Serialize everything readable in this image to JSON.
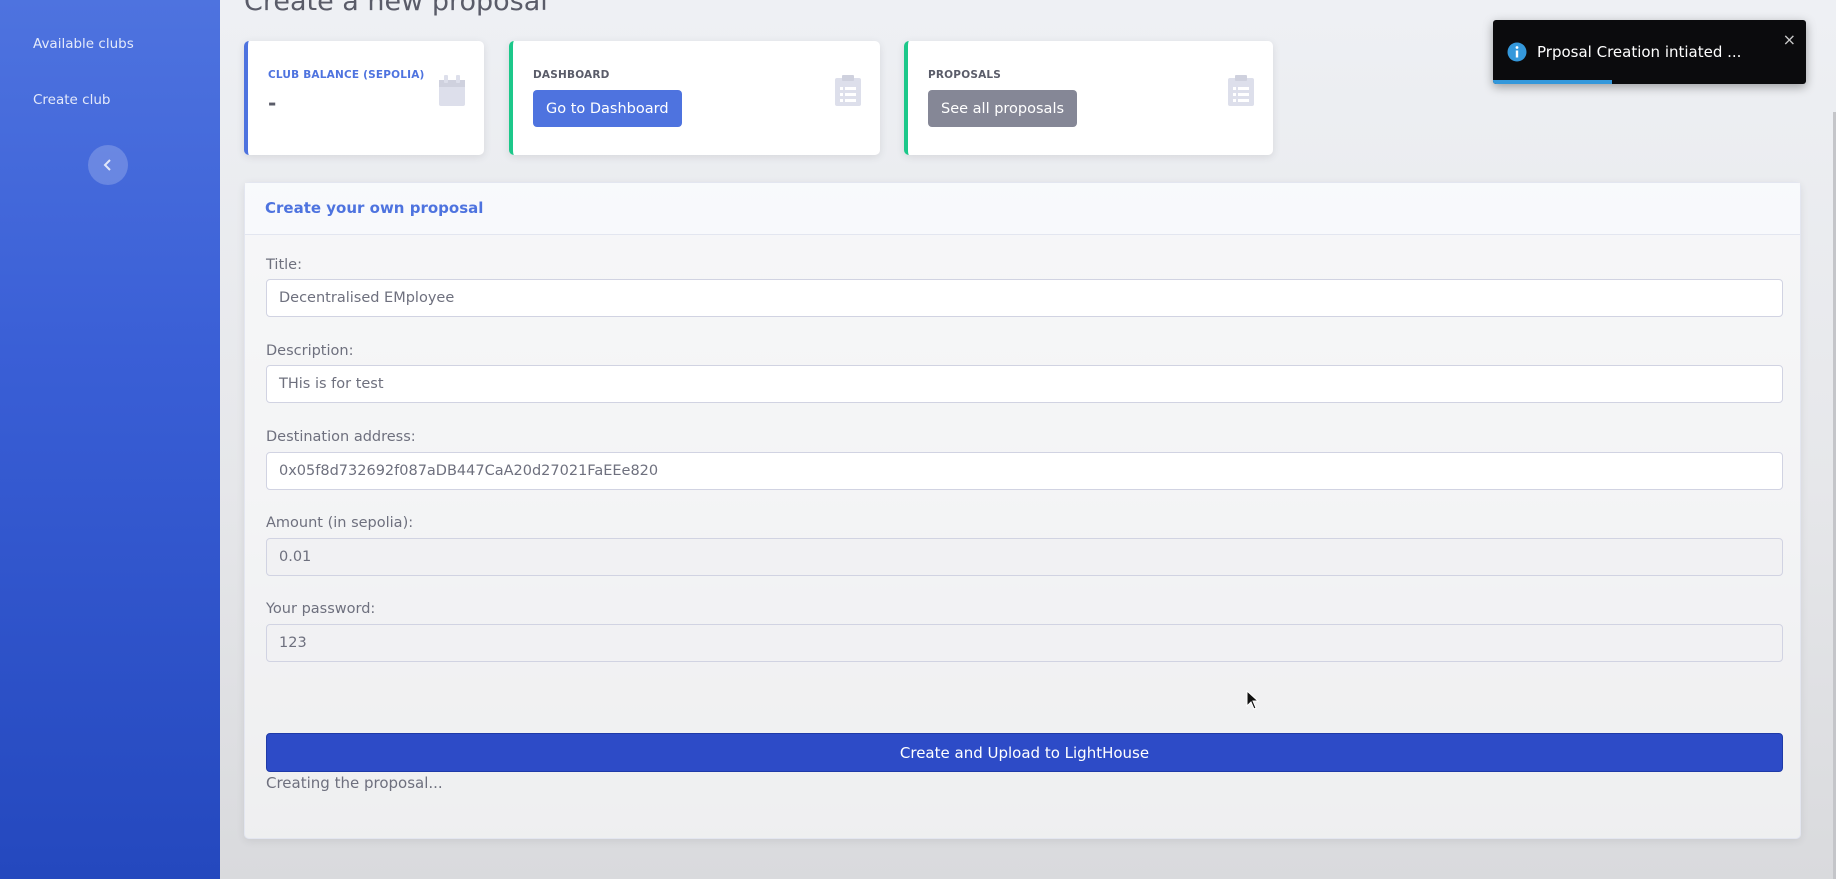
{
  "sidebar": {
    "items": [
      {
        "label": "Available clubs"
      },
      {
        "label": "Create club"
      }
    ],
    "toggle_icon": "chevron-left-icon"
  },
  "page": {
    "title": "Create a new proposal"
  },
  "cards": {
    "balance": {
      "label": "CLUB BALANCE (SEPOLIA)",
      "value": "-",
      "icon": "calendar-icon"
    },
    "dashboard": {
      "label": "DASHBOARD",
      "button": "Go to Dashboard",
      "icon": "clipboard-list-icon"
    },
    "proposals": {
      "label": "PROPOSALS",
      "button": "See all proposals",
      "icon": "clipboard-list-icon"
    }
  },
  "form": {
    "header": "Create your own proposal",
    "title_label": "Title:",
    "title_value": "Decentralised EMployee",
    "description_label": "Description:",
    "description_value": "THis is for test",
    "destination_label": "Destination address:",
    "destination_value": "0x05f8d732692f087aDB447CaA20d27021FaEEe820",
    "amount_label": "Amount (in sepolia):",
    "amount_value": "0.01",
    "password_label": "Your password:",
    "password_value": "123",
    "submit_label": "Create and Upload to LightHouse",
    "status": "Creating the proposal..."
  },
  "toast": {
    "message": "Prposal Creation intiated ...",
    "close": "×",
    "icon": "info-icon",
    "progress": 0.38
  },
  "colors": {
    "primary": "#4e73df",
    "success": "#1cc88a",
    "secondary": "#858796",
    "submit": "#2d4bc7",
    "toast_progress": "#3498db"
  }
}
